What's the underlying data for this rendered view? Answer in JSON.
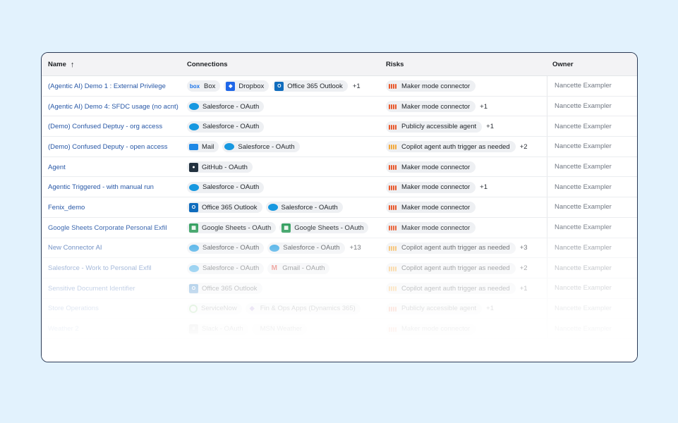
{
  "columns": {
    "name": "Name",
    "connections": "Connections",
    "risks": "Risks",
    "owner": "Owner"
  },
  "rows": [
    {
      "name": "(Agentic AI) Demo 1 : External Privilege",
      "connections": [
        {
          "label": "Box",
          "icon": "box"
        },
        {
          "label": "Dropbox",
          "icon": "dropbox"
        },
        {
          "label": "Office 365 Outlook",
          "icon": "outlook"
        }
      ],
      "connections_more": "+1",
      "risk": {
        "label": "Maker mode connector",
        "level": "high"
      },
      "risk_more": "",
      "owner": "Nancette Exampler"
    },
    {
      "name": "(Agentic AI) Demo 4: SFDC usage (no acnt)",
      "connections": [
        {
          "label": "Salesforce - OAuth",
          "icon": "salesforce"
        }
      ],
      "connections_more": "",
      "risk": {
        "label": "Maker mode connector",
        "level": "high"
      },
      "risk_more": "+1",
      "owner": "Nancette Exampler"
    },
    {
      "name": "(Demo) Confused Deptuy - org access",
      "connections": [
        {
          "label": "Salesforce - OAuth",
          "icon": "salesforce"
        }
      ],
      "connections_more": "",
      "risk": {
        "label": "Publicly accessible agent",
        "level": "high"
      },
      "risk_more": "+1",
      "owner": "Nancette Exampler"
    },
    {
      "name": "(Demo) Confused Deputy - open access",
      "connections": [
        {
          "label": "Mail",
          "icon": "mail"
        },
        {
          "label": "Salesforce - OAuth",
          "icon": "salesforce"
        }
      ],
      "connections_more": "",
      "risk": {
        "label": "Copilot agent auth trigger as needed",
        "level": "med"
      },
      "risk_more": "+2",
      "owner": "Nancette Exampler"
    },
    {
      "name": "Agent",
      "connections": [
        {
          "label": "GitHub - OAuth",
          "icon": "github"
        }
      ],
      "connections_more": "",
      "risk": {
        "label": "Maker mode connector",
        "level": "high"
      },
      "risk_more": "",
      "owner": "Nancette Exampler"
    },
    {
      "name": "Agentic Triggered - with manual run",
      "connections": [
        {
          "label": "Salesforce - OAuth",
          "icon": "salesforce"
        }
      ],
      "connections_more": "",
      "risk": {
        "label": "Maker mode connector",
        "level": "high"
      },
      "risk_more": "+1",
      "owner": "Nancette Exampler"
    },
    {
      "name": "Fenix_demo",
      "connections": [
        {
          "label": "Office 365 Outlook",
          "icon": "outlook"
        },
        {
          "label": "Salesforce - OAuth",
          "icon": "salesforce"
        }
      ],
      "connections_more": "",
      "risk": {
        "label": "Maker mode connector",
        "level": "high"
      },
      "risk_more": "",
      "owner": "Nancette Exampler"
    },
    {
      "name": "Google Sheets Corporate Personal Exfil",
      "connections": [
        {
          "label": "Google Sheets - OAuth",
          "icon": "google-sheets"
        },
        {
          "label": "Google Sheets - OAuth",
          "icon": "google-sheets"
        }
      ],
      "connections_more": "",
      "risk": {
        "label": "Maker mode connector",
        "level": "high"
      },
      "risk_more": "",
      "owner": "Nancette Exampler"
    },
    {
      "name": "New Connector AI",
      "connections": [
        {
          "label": "Salesforce - OAuth",
          "icon": "salesforce"
        },
        {
          "label": "Salesforce - OAuth",
          "icon": "salesforce"
        }
      ],
      "connections_more": "+13",
      "risk": {
        "label": "Copilot agent auth trigger as needed",
        "level": "med"
      },
      "risk_more": "+3",
      "owner": "Nancette Exampler"
    },
    {
      "name": "Salesforce - Work to Personal Exfil",
      "connections": [
        {
          "label": "Salesforce - OAuth",
          "icon": "salesforce"
        },
        {
          "label": "Gmail - OAuth",
          "icon": "gmail"
        }
      ],
      "connections_more": "",
      "risk": {
        "label": "Copilot agent auth trigger as needed",
        "level": "med"
      },
      "risk_more": "+2",
      "owner": "Nancette Exampler"
    },
    {
      "name": "Sensitive Document Identifier",
      "connections": [
        {
          "label": "Office 365 Outlook",
          "icon": "outlook"
        }
      ],
      "connections_more": "",
      "risk": {
        "label": "Copilot agent auth trigger as needed",
        "level": "med"
      },
      "risk_more": "+1",
      "owner": "Nancette Exampler"
    },
    {
      "name": "Store Operations",
      "connections": [
        {
          "label": "ServiceNow",
          "icon": "servicenow"
        },
        {
          "label": "Fin & Ops Apps (Dynamics 365)",
          "icon": "dynamics"
        }
      ],
      "connections_more": "",
      "risk": {
        "label": "Publicly accessible agent",
        "level": "high"
      },
      "risk_more": "+1",
      "owner": "Nancette Exampler"
    },
    {
      "name": "Weather 2",
      "connections": [
        {
          "label": "Slack - OAuth",
          "icon": "slack"
        },
        {
          "label": "MSN Weather",
          "icon": "msn-weather"
        }
      ],
      "connections_more": "",
      "risk": {
        "label": "Maker mode connector",
        "level": "high"
      },
      "risk_more": "",
      "owner": "Nancette Exampler"
    }
  ]
}
